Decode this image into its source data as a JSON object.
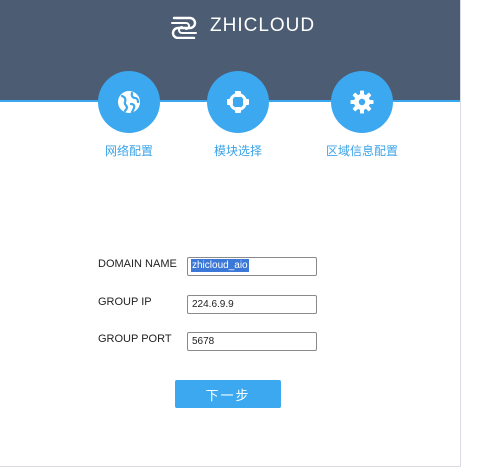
{
  "header": {
    "brand_name": "ZHICLOUD",
    "background_color": "#4c5c73",
    "accent_color": "#3ca8ef"
  },
  "steps": [
    {
      "label": "网络配置",
      "icon": "globe-icon"
    },
    {
      "label": "模块选择",
      "icon": "modules-icon"
    },
    {
      "label": "区域信息配置",
      "icon": "gear-icon"
    }
  ],
  "form": {
    "domain_name": {
      "label": "DOMAIN NAME",
      "value": "zhicloud_aio",
      "selected": true
    },
    "group_ip": {
      "label": "GROUP IP",
      "value": "224.6.9.9"
    },
    "group_port": {
      "label": "GROUP PORT",
      "value": "5678"
    }
  },
  "actions": {
    "next_label": "下一步"
  }
}
